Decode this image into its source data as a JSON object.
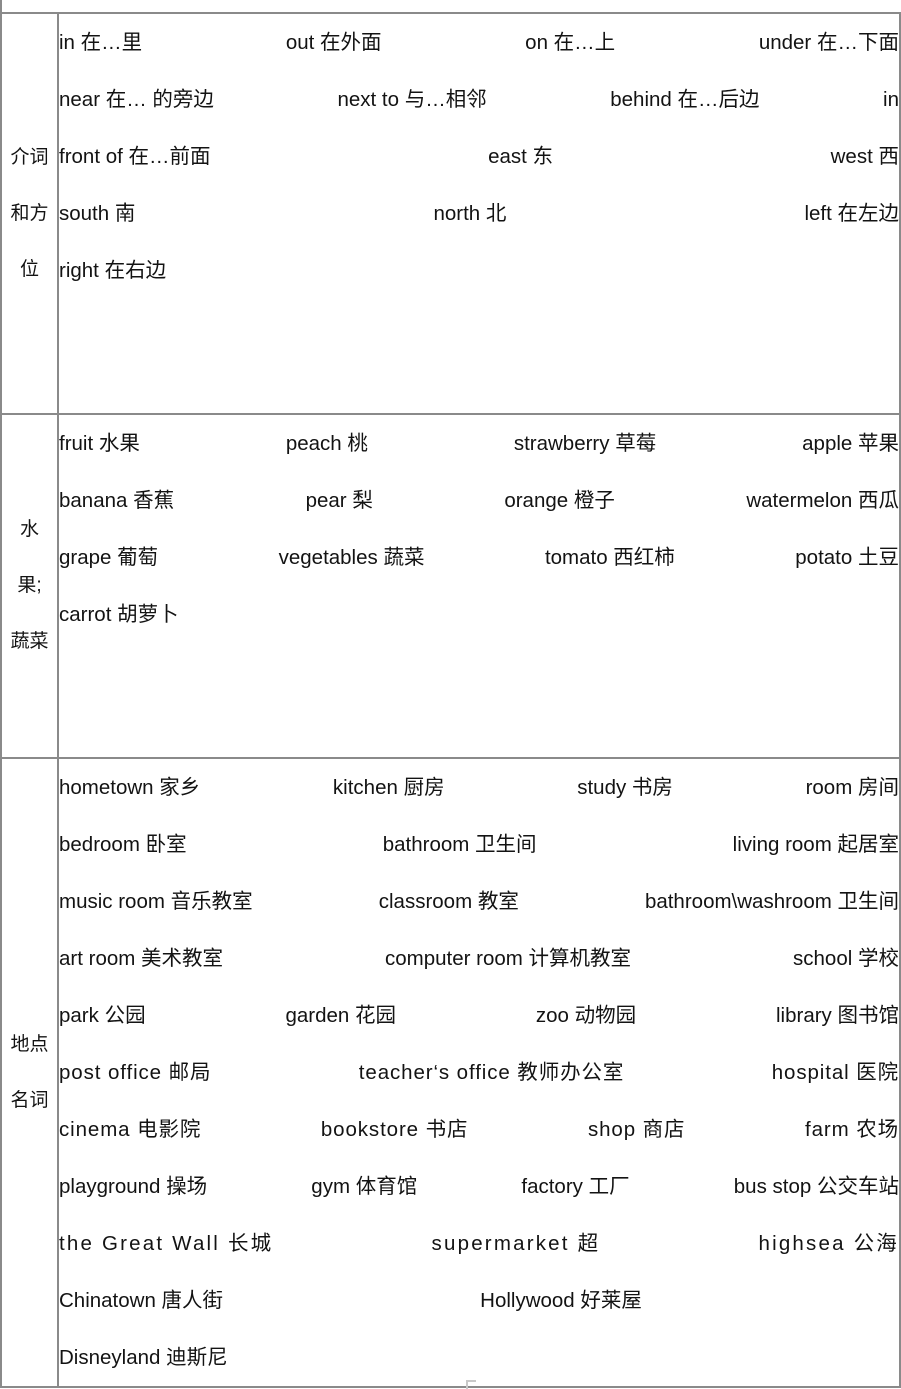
{
  "document": {
    "type": "vocabulary-table",
    "title": "English-Chinese Vocabulary Table"
  },
  "sections": [
    {
      "id": "prepositions",
      "category_label": "介词和方位",
      "lines": [
        {
          "justify": "between",
          "terms": [
            "in 在…里",
            "out 在外面",
            "on 在…上",
            "under 在…下面"
          ]
        },
        {
          "justify": "between",
          "terms": [
            "near 在… 的旁边",
            "next to 与…相邻",
            "behind 在…后边",
            "in"
          ]
        },
        {
          "justify": "between",
          "terms": [
            "front of 在…前面",
            "east 东",
            "west 西"
          ]
        },
        {
          "justify": "between",
          "terms": [
            "south 南",
            "north 北",
            "left 在左边"
          ]
        },
        {
          "justify": "flush",
          "terms": [
            "right 在右边"
          ]
        }
      ]
    },
    {
      "id": "fruits-vegetables",
      "category_label": "水果;蔬菜",
      "lines": [
        {
          "justify": "between",
          "terms": [
            "fruit 水果",
            "peach 桃",
            "strawberry 草莓",
            "apple 苹果"
          ]
        },
        {
          "justify": "between",
          "terms": [
            "banana 香蕉",
            "pear 梨",
            "orange 橙子",
            "watermelon 西瓜"
          ]
        },
        {
          "justify": "between",
          "terms": [
            "grape 葡萄",
            "vegetables 蔬菜",
            "tomato 西红柿",
            "potato 土豆"
          ]
        },
        {
          "justify": "flush",
          "terms": [
            "carrot 胡萝卜"
          ]
        }
      ]
    },
    {
      "id": "place-nouns",
      "category_label": "地点名词",
      "lines": [
        {
          "justify": "between",
          "terms": [
            "hometown 家乡",
            "kitchen 厨房",
            "study 书房",
            "room 房间"
          ]
        },
        {
          "justify": "between",
          "terms": [
            "bedroom 卧室",
            "bathroom 卫生间",
            "living room 起居室"
          ]
        },
        {
          "justify": "between",
          "terms": [
            "music room 音乐教室",
            "classroom 教室",
            "bathroom\\washroom 卫生间"
          ]
        },
        {
          "justify": "between",
          "terms": [
            "art room 美术教室",
            "computer room 计算机教室",
            "school 学校"
          ]
        },
        {
          "justify": "between",
          "terms": [
            "park 公园",
            "garden 花园",
            "zoo 动物园",
            "library 图书馆"
          ]
        },
        {
          "justify": "between",
          "spacing": "spread",
          "terms": [
            "post office 邮局",
            "teacher‘s office 教师办公室",
            "hospital 医院"
          ]
        },
        {
          "justify": "between",
          "spacing": "spread",
          "terms": [
            "cinema 电影院",
            "bookstore 书店",
            "shop 商店",
            "farm 农场"
          ]
        },
        {
          "justify": "between",
          "terms": [
            "playground 操场",
            "gym 体育馆",
            "factory 工厂",
            "bus stop 公交车站"
          ]
        },
        {
          "justify": "between",
          "spacing": "spread-wide",
          "terms": [
            "the Great Wall 长城",
            "supermarket 超",
            "highsea 公海"
          ]
        },
        {
          "justify": "between",
          "terms": [
            "Chinatown 唐人街",
            "Hollywood 好莱屋"
          ]
        },
        {
          "justify": "flush",
          "terms": [
            "Disneyland 迪斯尼"
          ]
        }
      ]
    }
  ],
  "colors": {
    "border": "#8a8a8a",
    "text": "#131313",
    "background": "#ffffff"
  }
}
